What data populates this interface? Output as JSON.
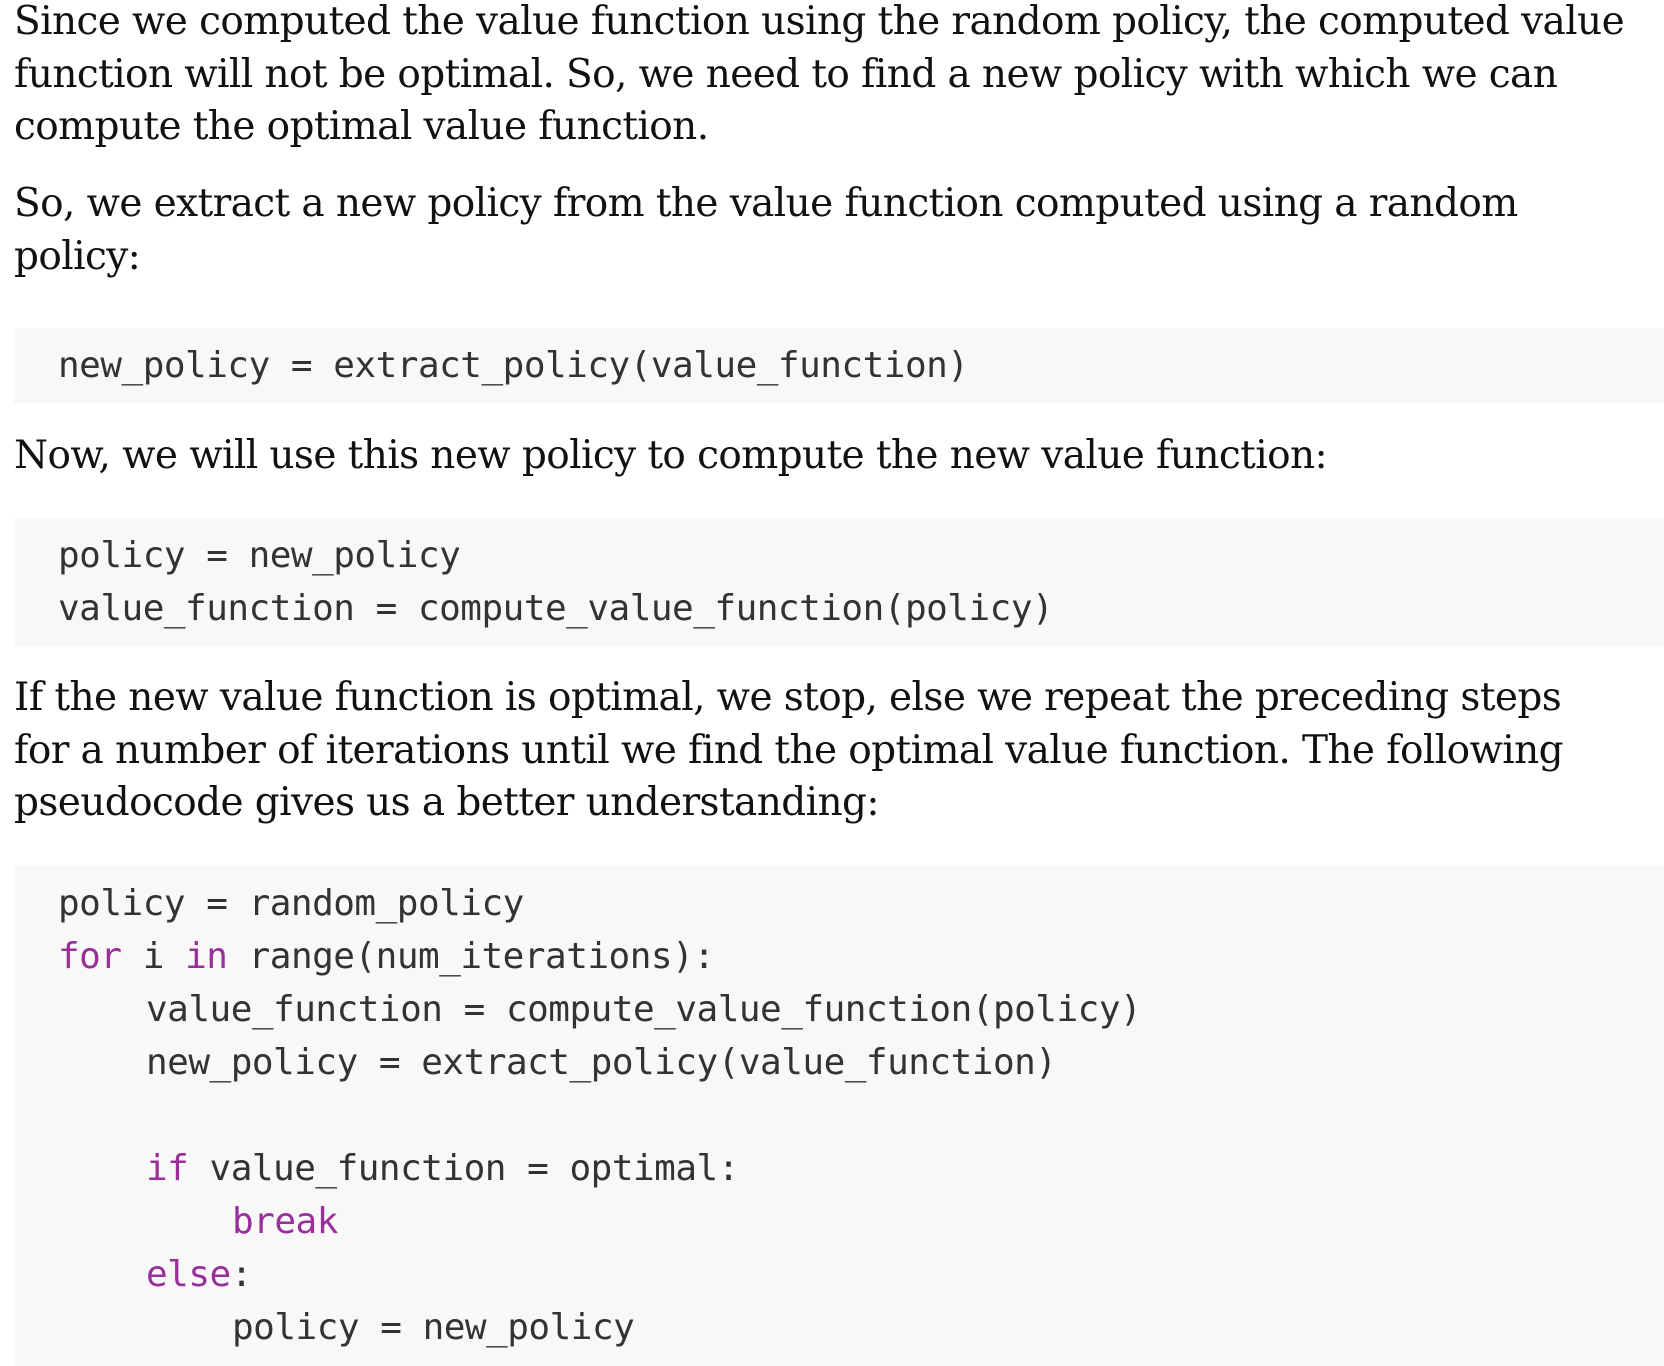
{
  "paragraphs": {
    "p1": [
      "Since we computed the value function using the random policy, the computed value",
      "function will not be optimal. So, we need to find a new policy with which we can",
      "compute the optimal value function."
    ],
    "p2": [
      "So, we extract a new policy from the value function computed using a random",
      "policy:"
    ],
    "p3": [
      "Now, we will use this new policy to compute the new value function:"
    ],
    "p4": [
      "If the new value function is optimal, we stop, else we repeat the preceding steps",
      "for a number of iterations until we find the optimal value function. The following",
      "pseudocode gives us a better understanding:"
    ]
  },
  "code1": {
    "line1": "new_policy = extract_policy(value_function)"
  },
  "code2": {
    "line1": "policy = new_policy",
    "line2": "value_function = compute_value_function(policy)"
  },
  "code3": {
    "line1": "policy = random_policy",
    "line2_kw_for": "for",
    "line2_var": " i ",
    "line2_kw_in": "in",
    "line2_rest": " range(num_iterations):",
    "line3": "value_function = compute_value_function(policy)",
    "line4": "new_policy = extract_policy(value_function)",
    "line6_kw_if": "if",
    "line6_rest": " value_function = optimal:",
    "line7_kw_break": "break",
    "line8_kw_else": "else",
    "line8_rest": ":",
    "line9": "policy = new_policy"
  }
}
